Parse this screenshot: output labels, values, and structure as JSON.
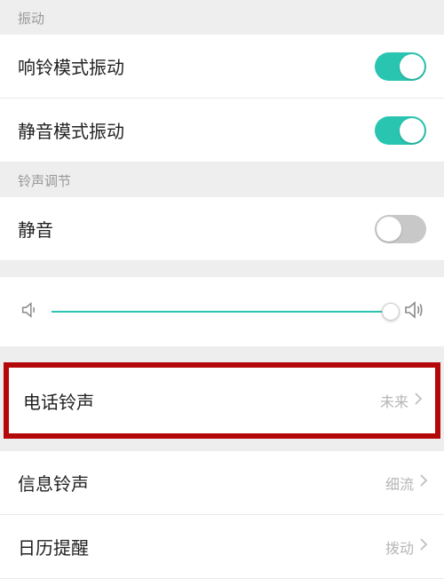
{
  "sections": {
    "vibration": {
      "header": "振动"
    },
    "tone_adjust": {
      "header": "铃声调节"
    }
  },
  "rows": {
    "ring_vibrate": {
      "label": "响铃模式振动",
      "on": true
    },
    "silent_vibrate": {
      "label": "静音模式振动",
      "on": true
    },
    "mute": {
      "label": "静音",
      "on": false
    },
    "phone_ringtone": {
      "label": "电话铃声",
      "value": "未来"
    },
    "message_ringtone": {
      "label": "信息铃声",
      "value": "细流"
    },
    "calendar_reminder": {
      "label": "日历提醒",
      "value": "拨动"
    }
  },
  "slider": {
    "position": 100
  },
  "icons": {
    "volume_low": "volume-low",
    "volume_high": "volume-high",
    "chevron": "chevron-right"
  }
}
